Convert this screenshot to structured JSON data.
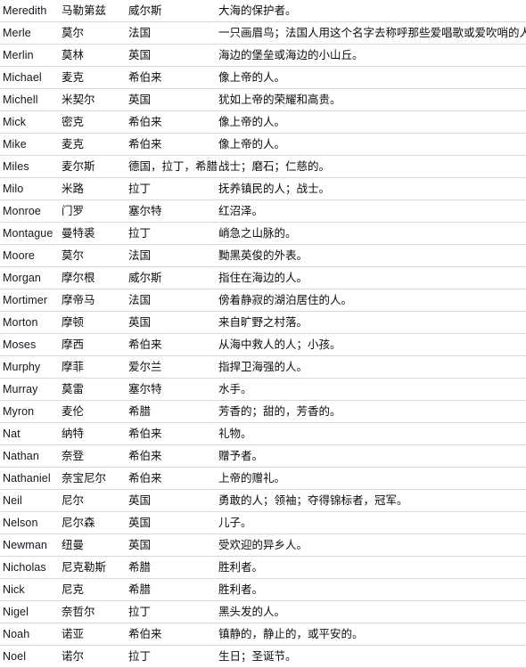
{
  "table": {
    "columns": [
      "name",
      "transliteration",
      "origin",
      "meaning"
    ],
    "border_color": "#d8d8e4",
    "text_color": "#111111",
    "background_color": "#ffffff",
    "rows": [
      {
        "name": "Meredith",
        "transliteration": "马勒第兹",
        "origin": "威尔斯",
        "meaning": "大海的保护者。"
      },
      {
        "name": "Merle",
        "transliteration": "莫尔",
        "origin": "法国",
        "meaning": "一只画眉鸟；法国人用这个名字去称呼那些爱唱歌或爱吹哨的人"
      },
      {
        "name": "Merlin",
        "transliteration": "莫林",
        "origin": "英国",
        "meaning": "海边的堡垒或海边的小山丘。"
      },
      {
        "name": "Michael",
        "transliteration": "麦克",
        "origin": "希伯来",
        "meaning": "像上帝的人。"
      },
      {
        "name": "Michell",
        "transliteration": "米契尔",
        "origin": "英国",
        "meaning": "犹如上帝的荣耀和高贵。"
      },
      {
        "name": "Mick",
        "transliteration": "密克",
        "origin": "希伯来",
        "meaning": "像上帝的人。"
      },
      {
        "name": "Mike",
        "transliteration": "麦克",
        "origin": "希伯来",
        "meaning": "像上帝的人。"
      },
      {
        "name": "Miles",
        "transliteration": "麦尔斯",
        "origin": "德国，拉丁，希腊",
        "meaning": "战士；磨石；仁慈的。"
      },
      {
        "name": "Milo",
        "transliteration": "米路",
        "origin": "拉丁",
        "meaning": "抚养镇民的人；战士。"
      },
      {
        "name": "Monroe",
        "transliteration": "门罗",
        "origin": "塞尔特",
        "meaning": "红沼泽。"
      },
      {
        "name": "Montague",
        "transliteration": "曼特裘",
        "origin": "拉丁",
        "meaning": "峭急之山脉的。"
      },
      {
        "name": "Moore",
        "transliteration": "莫尔",
        "origin": "法国",
        "meaning": "黝黑英俊的外表。"
      },
      {
        "name": "Morgan",
        "transliteration": "摩尔根",
        "origin": "威尔斯",
        "meaning": "指住在海边的人。"
      },
      {
        "name": "Mortimer",
        "transliteration": "摩帝马",
        "origin": "法国",
        "meaning": "傍着静寂的湖泊居住的人。"
      },
      {
        "name": "Morton",
        "transliteration": "摩顿",
        "origin": "英国",
        "meaning": "来自旷野之村落。"
      },
      {
        "name": "Moses",
        "transliteration": "摩西",
        "origin": "希伯来",
        "meaning": "从海中救人的人；小孩。"
      },
      {
        "name": "Murphy",
        "transliteration": "摩菲",
        "origin": "爱尔兰",
        "meaning": "指捍卫海强的人。"
      },
      {
        "name": "Murray",
        "transliteration": "莫雷",
        "origin": "塞尔特",
        "meaning": "水手。"
      },
      {
        "name": "Myron",
        "transliteration": "麦伦",
        "origin": "希腊",
        "meaning": "芳香的；甜的，芳香的。"
      },
      {
        "name": "Nat",
        "transliteration": "纳特",
        "origin": "希伯来",
        "meaning": "礼物。"
      },
      {
        "name": "Nathan",
        "transliteration": "奈登",
        "origin": "希伯来",
        "meaning": "赠予者。"
      },
      {
        "name": "Nathaniel",
        "transliteration": "奈宝尼尔",
        "origin": "希伯来",
        "meaning": "上帝的赠礼。"
      },
      {
        "name": "Neil",
        "transliteration": "尼尔",
        "origin": "英国",
        "meaning": "勇敢的人；领袖；夺得锦标者，冠军。"
      },
      {
        "name": "Nelson",
        "transliteration": "尼尔森",
        "origin": "英国",
        "meaning": "儿子。"
      },
      {
        "name": "Newman",
        "transliteration": "纽曼",
        "origin": "英国",
        "meaning": "受欢迎的异乡人。"
      },
      {
        "name": "Nicholas",
        "transliteration": "尼克勒斯",
        "origin": "希腊",
        "meaning": "胜利者。"
      },
      {
        "name": "Nick",
        "transliteration": "尼克",
        "origin": "希腊",
        "meaning": "胜利者。"
      },
      {
        "name": "Nigel",
        "transliteration": "奈哲尔",
        "origin": "拉丁",
        "meaning": "黑头发的人。"
      },
      {
        "name": "Noah",
        "transliteration": "诺亚",
        "origin": "希伯来",
        "meaning": "镇静的，静止的，或平安的。"
      },
      {
        "name": "Noel",
        "transliteration": "诺尔",
        "origin": "拉丁",
        "meaning": "生日；圣诞节。"
      }
    ]
  }
}
